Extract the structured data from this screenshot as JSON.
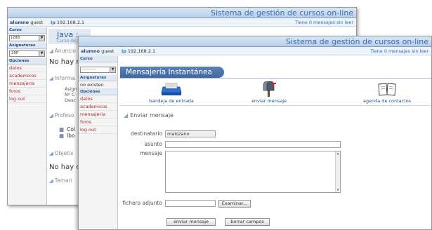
{
  "app": {
    "system_title": "Sistema de gestión de cursos on-line",
    "user_label": "alumno",
    "user_name": "guest",
    "ip": "192.168.2.1",
    "messages_status": "Tiene 0 mensajes sin leer"
  },
  "back_window": {
    "sidebar": {
      "curso_header": "Curso",
      "curso_value": "J288",
      "asignaturas_header": "Asignaturas",
      "asignaturas_value": "20P",
      "opciones_header": "Opciones",
      "options": [
        "datos",
        "academicos",
        "mensajeria",
        "foros",
        "log out"
      ]
    },
    "course_title": "Java :",
    "course_subtitle": "Curso de",
    "sections": {
      "anuncios": "Anuncio",
      "no_hay_1": "No hay r",
      "informacion": "Informa",
      "info_lines": [
        "Asign",
        "Nº C",
        "Desc"
      ],
      "profesores": "Profeso",
      "prof_items": [
        "Col",
        "Ibo"
      ],
      "objetivos": "Objetiv",
      "no_hay_2": "No hay o",
      "temario": "Temari"
    }
  },
  "front_window": {
    "sidebar": {
      "curso_header": "Curso",
      "curso_value": "----------",
      "asignaturas_header": "Asignaturas",
      "asignaturas_text": "no existen",
      "opciones_header": "Opciones",
      "options": [
        "datos",
        "academicos",
        "mensajeria",
        "foros",
        "log out"
      ]
    },
    "section_title": "Mensajería Instantánea",
    "tools": {
      "inbox": "bandeja de entrada",
      "send": "enviar mensaje",
      "contacts": "agenda de contactos"
    },
    "form": {
      "subtitle": "Enviar mensaje",
      "recipient_label": "destinatario",
      "recipient_value": "malozano",
      "subject_label": "asunto",
      "subject_value": "",
      "message_label": "mensaje",
      "message_value": "",
      "attachment_label": "fichero adjunto",
      "attachment_value": "",
      "browse_button": "Examinar...",
      "send_button": "enviar mensaje",
      "clear_button": "borrar campos"
    }
  }
}
